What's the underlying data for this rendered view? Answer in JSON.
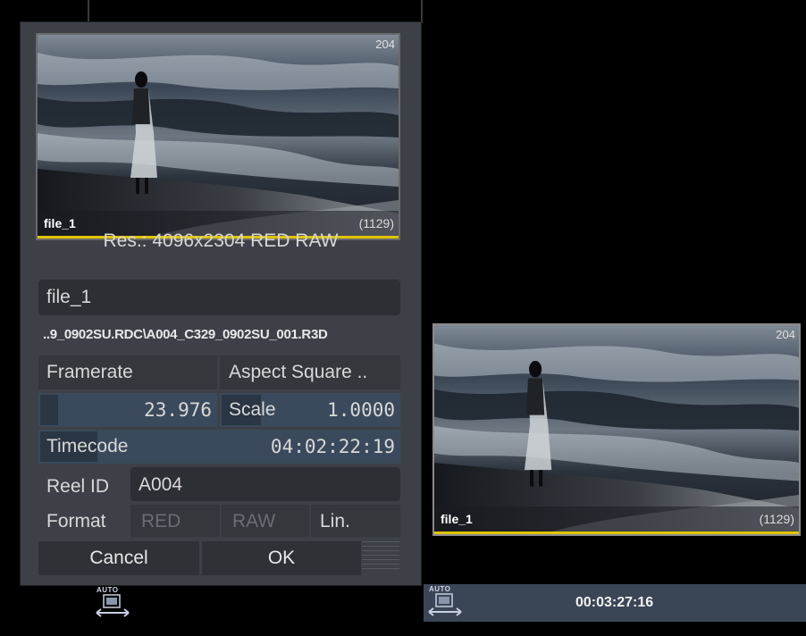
{
  "dialog": {
    "thumbnail": {
      "name": "file_1",
      "count": "(1129)",
      "badge": "204"
    },
    "resolution": "Res.: 4096x2304 RED RAW",
    "clip_name": "file_1",
    "path": "..9_0902SU.RDC\\A004_C329_0902SU_001.R3D",
    "framerate_label": "Framerate",
    "aspect_label": "Aspect Square ..",
    "framerate_value": "23.976",
    "scale_label": "Scale",
    "scale_value": "1.0000",
    "timecode_label": "Timecode",
    "timecode_value": "04:02:22:19",
    "reelid_label": "Reel ID",
    "reelid_value": "A004",
    "format_label": "Format",
    "format_options": [
      "RED",
      "RAW",
      "Lin."
    ],
    "cancel_label": "Cancel",
    "ok_label": "OK"
  },
  "preview": {
    "name": "file_1",
    "count": "(1129)",
    "badge": "204"
  },
  "auto_label": "AUTO",
  "auto_label_2": "AUTO",
  "timeline_timecode": "00:03:27:16",
  "colors": {
    "accent_yellow": "#e1c400",
    "dialog_bg": "#3d4147",
    "field_bg": "#2c2f34"
  }
}
